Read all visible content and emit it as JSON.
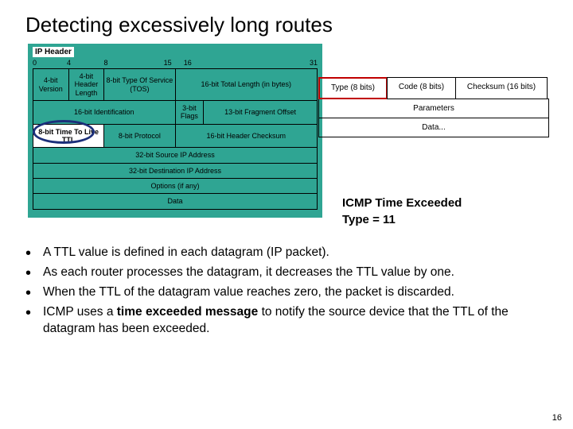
{
  "title": "Detecting excessively long routes",
  "ip_header": {
    "label": "IP Header",
    "ruler": {
      "b0": "0",
      "b4": "4",
      "b8": "8",
      "b15": "15",
      "b16": "16",
      "b31": "31"
    },
    "row1": {
      "version": "4-bit Version",
      "hlen": "4-bit Header Length",
      "tos": "8-bit Type Of Service (TOS)",
      "totlen": "16-bit Total Length (in bytes)"
    },
    "row2": {
      "id": "16-bit Identification",
      "flags": "3-bit Flags",
      "frag": "13-bit Fragment Offset"
    },
    "row3": {
      "ttl": "8-bit Time To Live TTL",
      "proto": "8-bit Protocol",
      "cksum": "16-bit Header Checksum"
    },
    "row4": "32-bit Source IP Address",
    "row5": "32-bit Destination IP Address",
    "row6": "Options (if any)",
    "row7": "Data"
  },
  "icmp": {
    "type_cell": "Type (8 bits)",
    "code_cell": "Code (8 bits)",
    "checksum_cell": "Checksum (16 bits)",
    "params": "Parameters",
    "data": "Data..."
  },
  "caption": {
    "line1": "ICMP Time Exceeded",
    "line2": "Type = 11"
  },
  "bullets": {
    "b1": "A TTL value is defined in each datagram (IP packet).",
    "b2": "As each router processes the datagram, it decreases the TTL value by one.",
    "b3": "When the TTL of the datagram value reaches zero, the packet is discarded.",
    "b4a": "ICMP uses a ",
    "b4b": "time exceeded message",
    "b4c": " to notify the source device that the TTL of the datagram has been exceeded."
  },
  "page_number": "16"
}
